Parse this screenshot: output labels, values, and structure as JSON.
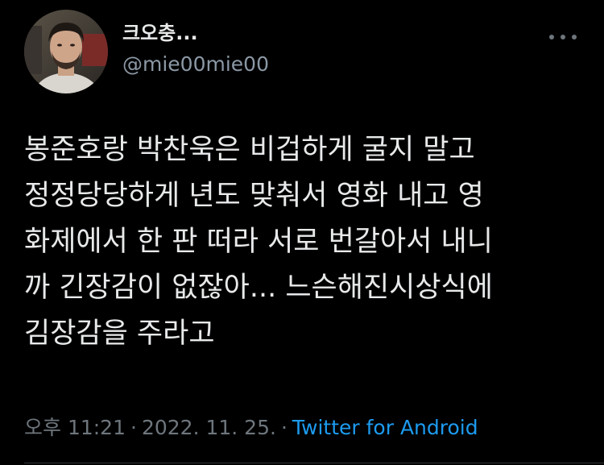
{
  "author": {
    "display_name": "크오충...",
    "handle": "@mie00mie00"
  },
  "more_icon": "more-horizontal-icon",
  "tweet": {
    "text": "봉준호랑 박찬욱은 비겁하게 굴지 말고\n정정당당하게 년도 맞춰서 영화 내고 영\n화제에서 한 판 떠라 서로 번갈아서 내니\n까 긴장감이 없잖아... 느슨해진시상식에\n김장감을 주라고"
  },
  "meta": {
    "time": "오후 11:21",
    "separator": "·",
    "date": "2022. 11. 25.",
    "separator2": "·",
    "source": "Twitter for Android"
  },
  "colors": {
    "background": "#000000",
    "text": "#e7e9ea",
    "secondary": "#8b98a5",
    "meta": "#6e767d",
    "link": "#1d9bf0"
  }
}
